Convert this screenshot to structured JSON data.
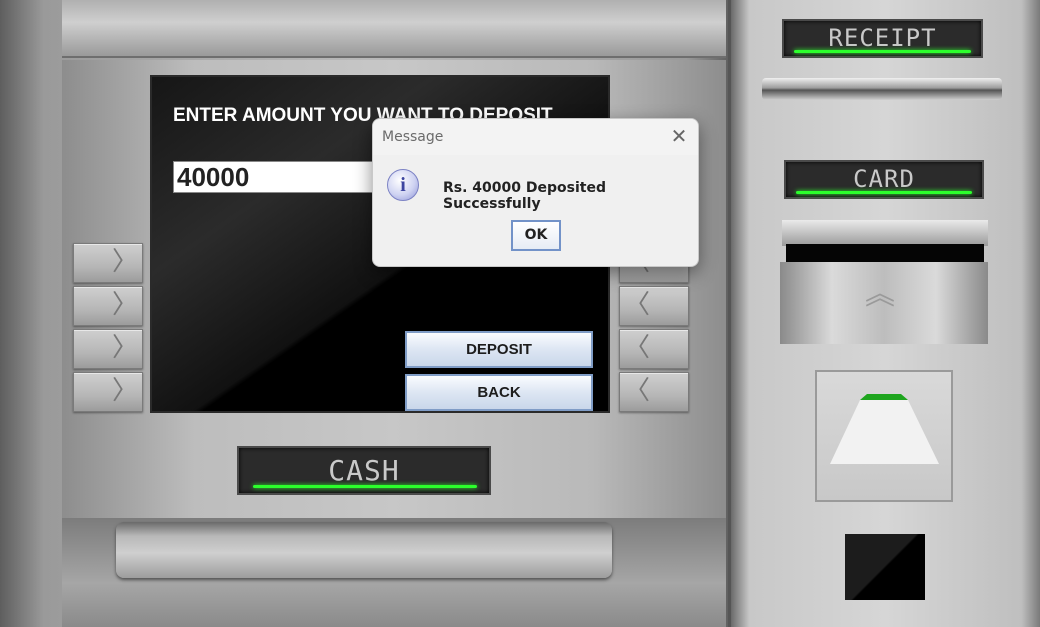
{
  "screen": {
    "prompt": "ENTER AMOUNT YOU WANT TO DEPOSIT",
    "amount_value": "40000",
    "deposit_label": "DEPOSIT",
    "back_label": "BACK"
  },
  "slots": {
    "receipt_label": "RECEIPT",
    "card_label": "CARD",
    "cash_label": "CASH"
  },
  "side_keys": {
    "left_glyph": "〉",
    "right_glyph": "〈"
  },
  "dialog": {
    "title": "Message",
    "message": "Rs. 40000 Deposited Successfully",
    "ok_label": "OK",
    "close_glyph": "✕",
    "icon_glyph": "i"
  },
  "colors": {
    "led_green": "#2cff2c",
    "button_border": "#7f9cc6"
  },
  "icons": [
    "chevron-right-icon",
    "chevron-left-icon",
    "info-icon",
    "close-icon",
    "card-arrow-icon"
  ]
}
